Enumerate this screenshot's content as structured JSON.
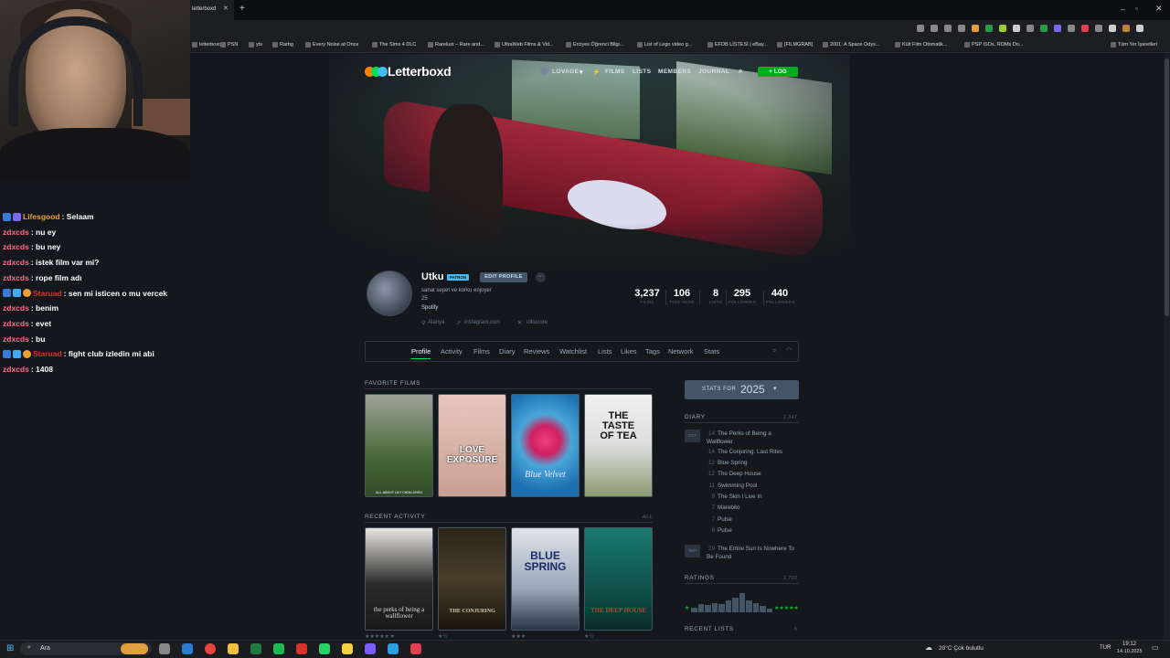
{
  "stream": {
    "chat": [
      {
        "user": "Lifesgood",
        "user_color": "#f0a030",
        "badges": [
          "#3a7bd5",
          "#7b68ee"
        ],
        "message": "Selaam"
      },
      {
        "user": "zdxcds",
        "user_color": "#ff6b8a",
        "badges": [],
        "message": "nu ey"
      },
      {
        "user": "zdxcds",
        "user_color": "#ff6b8a",
        "badges": [],
        "message": "bu ney"
      },
      {
        "user": "zdxcds",
        "user_color": "#ff6b8a",
        "badges": [],
        "message": "istek film var mi?"
      },
      {
        "user": "zdxcds",
        "user_color": "#ff6b8a",
        "badges": [],
        "message": "rope film adı"
      },
      {
        "user": "Staruad",
        "user_color": "#d9342b",
        "badges": [
          "#3a7bd5",
          "#3fa9f5",
          "#f0a030"
        ],
        "message": "sen mi isticen o mu vercek"
      },
      {
        "user": "zdxcds",
        "user_color": "#ff6b8a",
        "badges": [],
        "message": "benim"
      },
      {
        "user": "zdxcds",
        "user_color": "#ff6b8a",
        "badges": [],
        "message": "evet"
      },
      {
        "user": "zdxcds",
        "user_color": "#ff6b8a",
        "badges": [],
        "message": "bu"
      },
      {
        "user": "Staruad",
        "user_color": "#d9342b",
        "badges": [
          "#3a7bd5",
          "#3fa9f5",
          "#f0a030"
        ],
        "message": "fight club izledin mi abi"
      },
      {
        "user": "zdxcds",
        "user_color": "#ff6b8a",
        "badges": [],
        "message": "1408"
      }
    ]
  },
  "browser": {
    "active_tab": "letterboxd",
    "bookmarks": [
      "letterboxd",
      "PSN",
      "yts",
      "Rarbg",
      "Every Noise at Once",
      "The Sims 4 DLC",
      "Rarelust – Rare and...",
      "UltraWeb Films & Vid...",
      "Erciyes Öğrenci Bilgi...",
      "List of Lego video g...",
      "EFDB LİSTESİ | eBay...",
      "[FILMGRAB]",
      "2001: A Space Odys...",
      "Kült Film Otomatik...",
      "PSP ISOs, ROMs Do..."
    ],
    "all_bookmarks": "Tüm Yer İşaretleri"
  },
  "site": {
    "logo": "Letterboxd",
    "nav": {
      "user": "LOVAGE",
      "films": "FILMS",
      "lists": "LISTS",
      "members": "MEMBERS",
      "journal": "JOURNAL",
      "log": "+ LOG"
    },
    "brand_colors": {
      "orange": "#ff8000",
      "green": "#00e054",
      "blue": "#40bcf4"
    }
  },
  "profile": {
    "name": "Utku",
    "badge": "PATRON",
    "edit": "EDIT PROFILE",
    "bio_lines": [
      "sanat sepet ve korku enjoyer",
      "25",
      "Spotify"
    ],
    "location": "Alanya",
    "instagram": "instagram.com",
    "twitter": "utkucore",
    "stats": [
      {
        "value": "3,237",
        "label": "FILMS"
      },
      {
        "value": "106",
        "label": "THIS YEAR"
      },
      {
        "value": "8",
        "label": "LISTS"
      },
      {
        "value": "295",
        "label": "FOLLOWING"
      },
      {
        "value": "440",
        "label": "FOLLOWERS"
      }
    ]
  },
  "subnav": [
    "Profile",
    "Activity",
    "Films",
    "Diary",
    "Reviews",
    "Watchlist",
    "Lists",
    "Likes",
    "Tags",
    "Network",
    "Stats"
  ],
  "favorites": {
    "heading": "FAVORITE FILMS",
    "films": [
      {
        "title": "",
        "caption": "ALL ABOUT LILY CHOU-CHOU",
        "bg": "linear-gradient(180deg,#9fa39a,#4a6a3a 60%,#2f4a26)"
      },
      {
        "title": "LOVE EXPOSURE",
        "caption": "",
        "bg": "linear-gradient(180deg,#e8c6bd,#c9a093)"
      },
      {
        "title": "Blue Velvet",
        "caption": "",
        "bg": "radial-gradient(circle at 50% 45%,#f04080 0%,#d02060 22%,#4aa6d8 40%,#1b6fb0 80%)"
      },
      {
        "title": "THE TASTE OF TEA",
        "caption": "",
        "bg": "linear-gradient(180deg,#f0f0f0 0%,#ddd 50%,#8a9a70 100%)"
      }
    ]
  },
  "recent": {
    "heading": "RECENT ACTIVITY",
    "all": "ALL",
    "films": [
      {
        "title": "the perks of being a wallflower",
        "bg": "linear-gradient(180deg,#e8e6e2,#2a2a2a 55%,#1a1a1a)"
      },
      {
        "title": "THE CONJURING",
        "bg": "linear-gradient(180deg,#2a2418,#4a3e2a 50%,#1a160e)"
      },
      {
        "title": "BLUE SPRING",
        "bg": "linear-gradient(180deg,#dfe4ea,#9aa6b8 60%,#2a3446)"
      },
      {
        "title": "THE DEEP HOUSE",
        "bg": "linear-gradient(180deg,#1a7a6e,#0e4a44 70%,#0a2a28)"
      }
    ],
    "ratings": [
      "★★★★★ ♥",
      "★½",
      "★★★",
      "★½"
    ]
  },
  "sidebar": {
    "stats_for": "STATS FOR",
    "year": "2025",
    "diary_heading": "DIARY",
    "diary_count": "2,347",
    "diary": [
      {
        "day": "14",
        "title": "The Perks of Being a Wallflower"
      },
      {
        "day": "14",
        "title": "The Conjuring: Last Rites"
      },
      {
        "day": "12",
        "title": "Blue Spring"
      },
      {
        "day": "12",
        "title": "The Deep House"
      },
      {
        "day": "11",
        "title": "Swimming Pool"
      },
      {
        "day": "9",
        "title": "The Skin I Live In"
      },
      {
        "day": "7",
        "title": "Marebito"
      },
      {
        "day": "7",
        "title": "Pulse"
      },
      {
        "day": "6",
        "title": "Pulse"
      },
      {
        "day": "29",
        "title": "The Entire Sun Is Nowhere To Be Found"
      }
    ],
    "ratings_heading": "RATINGS",
    "ratings_count": "2,702",
    "ratings_hist": [
      0.25,
      0.4,
      0.35,
      0.45,
      0.4,
      0.6,
      0.75,
      0.95,
      0.6,
      0.45,
      0.3,
      0.2
    ],
    "recent_lists": "RECENT LISTS",
    "recent_lists_count": "8"
  },
  "taskbar": {
    "search": "Ara",
    "weather": "20°C  Çok bulutlu",
    "lang": "TUR",
    "time": "19:12",
    "date": "14.10.2025"
  }
}
